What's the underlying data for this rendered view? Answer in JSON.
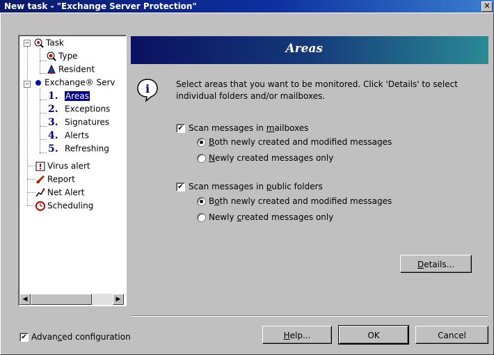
{
  "window": {
    "title": "New task - \"Exchange Server Protection\"",
    "close_label": "✕"
  },
  "tree": {
    "items": [
      {
        "label": "Task",
        "icon": "task-icon"
      },
      {
        "label": "Type",
        "icon": "type-icon"
      },
      {
        "label": "Resident",
        "icon": "resident-icon"
      },
      {
        "label": "Exchange® Serv",
        "icon": "exchange-icon"
      },
      {
        "num": "1.",
        "label": "Areas",
        "selected": true
      },
      {
        "num": "2.",
        "label": "Exceptions"
      },
      {
        "num": "3.",
        "label": "Signatures"
      },
      {
        "num": "4.",
        "label": "Alerts"
      },
      {
        "num": "5.",
        "label": "Refreshing"
      },
      {
        "label": "Virus alert",
        "icon": "virus-alert-icon"
      },
      {
        "label": "Report",
        "icon": "report-icon"
      },
      {
        "label": "Net Alert",
        "icon": "net-alert-icon"
      },
      {
        "label": "Scheduling",
        "icon": "scheduling-icon"
      }
    ],
    "expander_minus": "−"
  },
  "banner": {
    "title": "Areas"
  },
  "info": {
    "text": "Select areas that you want to be monitored. Click 'Details' to select individual folders and/or mailboxes."
  },
  "mailboxes": {
    "checkbox_pre": "Scan messages in ",
    "checkbox_key": "m",
    "checkbox_post": "ailboxes",
    "checked": true,
    "opt1_key": "B",
    "opt1_post": "oth newly created and modified messages",
    "opt2_key": "N",
    "opt2_post": "ewly created messages only",
    "selected": 1
  },
  "public": {
    "checkbox_pre": "Scan messages in ",
    "checkbox_key": "p",
    "checkbox_post": "ublic folders",
    "checked": true,
    "opt1_pre": "B",
    "opt1_key": "o",
    "opt1_post": "th newly created and modified messages",
    "opt2_pre": "Newly ",
    "opt2_key": "c",
    "opt2_post": "reated messages only",
    "selected": 1
  },
  "buttons": {
    "details_key": "D",
    "details_post": "etails...",
    "help_key": "H",
    "help_post": "elp...",
    "ok": "OK",
    "cancel": "Cancel"
  },
  "advanced": {
    "pre": "Advan",
    "key": "c",
    "post": "ed configuration",
    "checked": true
  },
  "check_mark": "✔",
  "scroll": {
    "left": "◀",
    "right": "▶"
  }
}
